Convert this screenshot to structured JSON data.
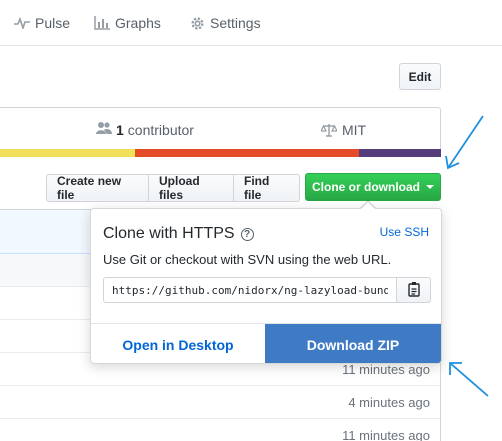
{
  "nav": {
    "items": [
      {
        "label": "Pulse",
        "icon": "pulse-icon"
      },
      {
        "label": "Graphs",
        "icon": "graph-icon"
      },
      {
        "label": "Settings",
        "icon": "gear-icon"
      }
    ]
  },
  "edit_label": "Edit",
  "summary": {
    "contributors_count": "1",
    "contributors_label": "contributor",
    "license": "MIT"
  },
  "language_bar": {
    "colors": [
      "#f1e05a",
      "#e34c26",
      "#563d7c"
    ],
    "shares": [
      0.305,
      0.51,
      0.185
    ]
  },
  "toolbar": {
    "create_new_file": "Create new file",
    "upload_files": "Upload files",
    "find_file": "Find file",
    "clone_or_download": "Clone or download",
    "clone_color": "#28a745"
  },
  "file_ages": [
    "11 minutes ago",
    "4 minutes ago",
    "11 minutes ago"
  ],
  "clone_popup": {
    "title": "Clone with HTTPS",
    "use_ssh": "Use SSH",
    "description": "Use Git or checkout with SVN using the web URL.",
    "url": "https://github.com/nidorx/ng-lazyload-bundle.git",
    "open_in_desktop": "Open in Desktop",
    "download_zip": "Download ZIP",
    "download_zip_color": "#3f7ac5"
  },
  "annotation_color": "#1e90e0"
}
